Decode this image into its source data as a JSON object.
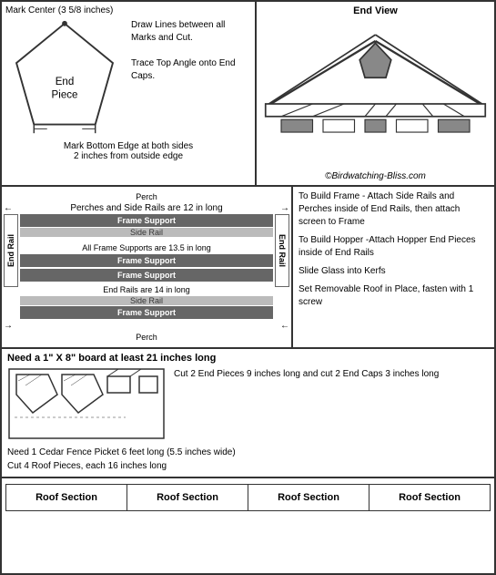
{
  "top": {
    "left": {
      "mark_center": "Mark Center (3 5/8 inches)",
      "draw_lines": "Draw Lines between all Marks and Cut.",
      "trace_angle": "Trace Top Angle onto End Caps.",
      "bottom_mark": "Mark Bottom Edge at both sides",
      "bottom_mark2": "2 inches from outside edge",
      "end_piece_label": "End Piece"
    },
    "right": {
      "end_view": "End View",
      "copyright": "©Birdwatching-Bliss.com"
    }
  },
  "middle": {
    "labels": {
      "perch": "Perch",
      "frame_support": "Frame Support",
      "side_rail": "Side Rail",
      "perches_rails_note": "Perches and Side Rails are 12 in long",
      "all_supports_note": "All Frame Supports are 13.5 in long",
      "end_rails_note": "End Rails are 14 in long",
      "end_rail": "End Rail"
    },
    "instructions": {
      "build_frame": "To Build Frame - Attach Side Rails and Perches inside of End Rails, then attach screen to Frame",
      "build_hopper": "To Build Hopper -Attach Hopper End Pieces inside of End Rails",
      "slide_glass": "Slide Glass into Kerfs",
      "removable_roof": "Set Removable Roof in Place, fasten with 1 screw"
    }
  },
  "lower": {
    "board_header": "Need a 1\" X 8\" board at least 21 inches long",
    "cut_instructions": "Cut 2 End Pieces 9 inches long and cut 2 End Caps 3 inches long",
    "fence_info": "Need 1 Cedar Fence Picket 6 feet long (5.5 inches wide)",
    "fence_info2": "Cut 4 Roof Pieces, each 16 inches long"
  },
  "bottom": {
    "roof_sections": [
      "Roof Section",
      "Roof Section",
      "Roof Section",
      "Roof Section"
    ]
  }
}
